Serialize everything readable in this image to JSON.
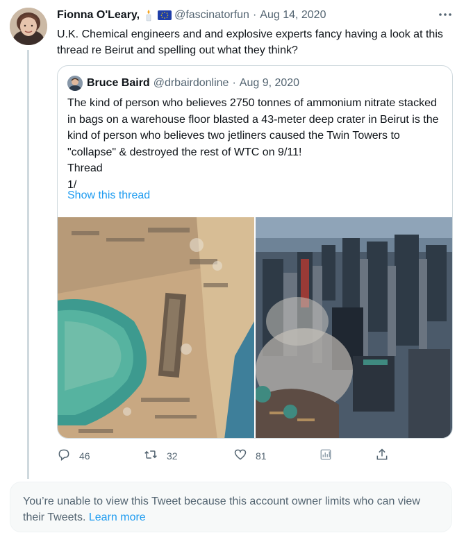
{
  "tweet": {
    "display_name": "Fionna O'Leary,",
    "handle": "@fascinatorfun",
    "separator": "·",
    "date": "Aug 14, 2020",
    "text": "U.K. Chemical engineers and and explosive experts fancy having a look at this thread re Beirut and spelling out what they think?"
  },
  "quoted_tweet": {
    "display_name": "Bruce Baird",
    "handle": "@drbairdonline",
    "separator": "·",
    "date": "Aug 9, 2020",
    "lines": [
      "The kind of person who believes 2750 tonnes of ammonium nitrate stacked in bags on a warehouse floor blasted a 43-meter deep crater in Beirut is the kind of person who believes two jetliners caused the Twin Towers to \"collapse\" & destroyed the rest of WTC on 9/11!",
      "Thread",
      "1/"
    ],
    "show_thread_label": "Show this thread"
  },
  "actions": {
    "reply_count": "46",
    "retweet_count": "32",
    "like_count": "81"
  },
  "notice": {
    "text": "You’re unable to view this Tweet because this account owner limits who can view their Tweets.",
    "link_label": "Learn more"
  },
  "colors": {
    "accent": "#1d9bf0",
    "secondary_text": "#536471",
    "border": "#cfd9de"
  },
  "icons": [
    "candle-icon",
    "eu-flag-icon",
    "more-icon",
    "reply-icon",
    "retweet-icon",
    "like-icon",
    "analytics-icon",
    "share-icon"
  ]
}
